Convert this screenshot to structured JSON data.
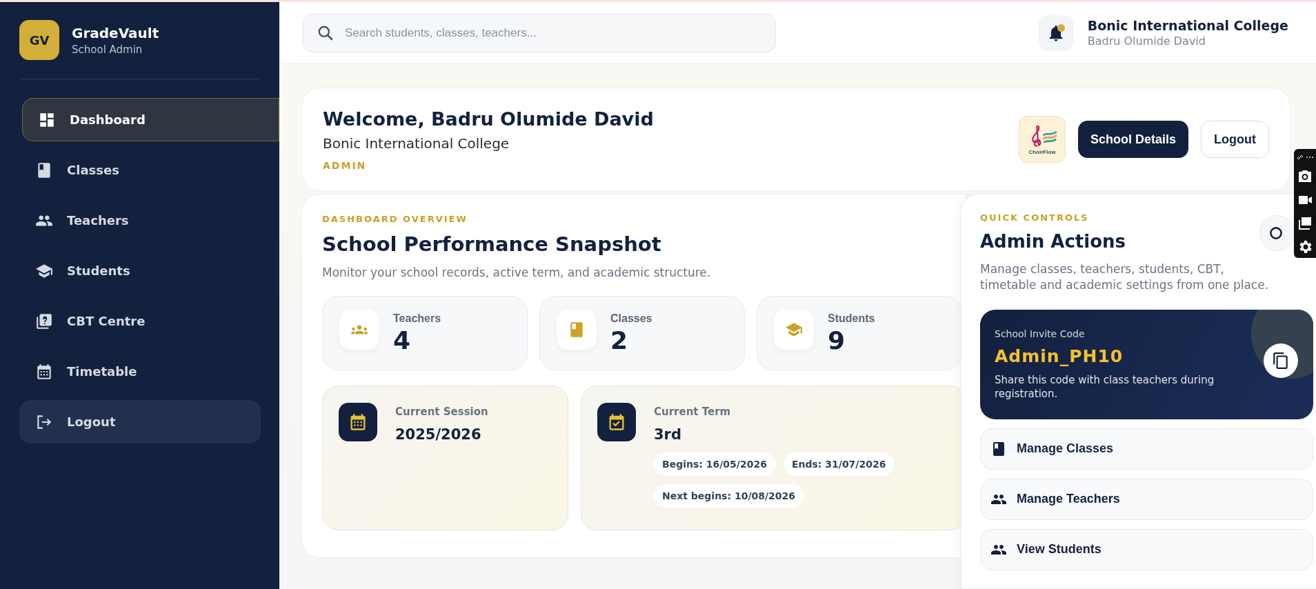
{
  "brand": {
    "initials": "GV",
    "name": "GradeVault",
    "subtitle": "School Admin"
  },
  "sidebar": {
    "items": [
      {
        "label": "Dashboard",
        "selected": true,
        "kind": "link"
      },
      {
        "label": "Classes",
        "selected": false,
        "kind": "link"
      },
      {
        "label": "Teachers",
        "selected": false,
        "kind": "link"
      },
      {
        "label": "Students",
        "selected": false,
        "kind": "link"
      },
      {
        "label": "CBT Centre",
        "selected": false,
        "kind": "link"
      },
      {
        "label": "Timetable",
        "selected": false,
        "kind": "link"
      },
      {
        "label": "Logout",
        "selected": false,
        "kind": "action"
      }
    ]
  },
  "header": {
    "search": {
      "placeholder": "Search students, classes, teachers..."
    },
    "notifications": {
      "unread": true
    },
    "school_name": "Bonic International College",
    "user_name": "Badru Olumide David"
  },
  "welcome": {
    "title": "Welcome, Badru Olumide David",
    "school": "Bonic International College",
    "role": "ADMIN",
    "logo": {
      "caption": "ChoirFlow"
    },
    "buttons": [
      {
        "label": "School Details",
        "kind": "primary"
      },
      {
        "label": "Logout",
        "kind": "secondary"
      }
    ]
  },
  "overview": {
    "eyebrow": "DASHBOARD OVERVIEW",
    "title": "School Performance Snapshot",
    "description": "Monitor your school records, active term, and academic structure.",
    "stats": [
      {
        "label": "Teachers",
        "value": "4"
      },
      {
        "label": "Classes",
        "value": "2"
      },
      {
        "label": "Students",
        "value": "9"
      }
    ],
    "session": {
      "label": "Current Session",
      "value": "2025/2026"
    },
    "term": {
      "label": "Current Term",
      "value": "3rd",
      "dates": [
        "Begins: 16/05/2026",
        "Ends: 31/07/2026",
        "Next begins: 10/08/2026"
      ]
    }
  },
  "quick_controls": {
    "eyebrow": "QUICK CONTROLS",
    "title": "Admin Actions",
    "description": "Manage classes, teachers, students, CBT, timetable and academic settings from one place.",
    "invite": {
      "label": "School Invite Code",
      "code": "Admin_PH10",
      "note": "Share this code with class teachers during registration."
    },
    "actions": [
      {
        "label": "Manage Classes"
      },
      {
        "label": "Manage Teachers"
      },
      {
        "label": "View Students"
      }
    ]
  }
}
